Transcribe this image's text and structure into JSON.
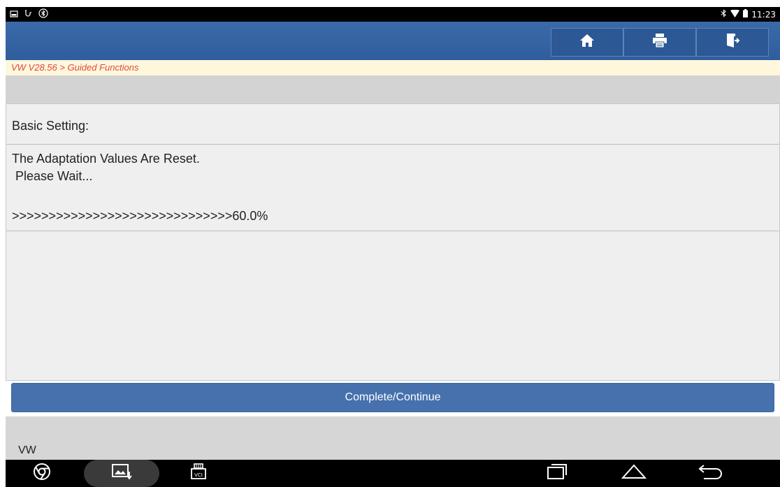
{
  "status_bar": {
    "time": "11:23"
  },
  "header": {
    "buttons": [
      {
        "name": "home",
        "icon": "home-icon"
      },
      {
        "name": "print",
        "icon": "printer-icon"
      },
      {
        "name": "exit",
        "icon": "exit-door-icon"
      }
    ]
  },
  "breadcrumb": "VW V28.56 > Guided Functions",
  "panel": {
    "title": "Basic Setting:",
    "message_line1": "The Adaptation Values Are Reset.",
    "message_line2": " Please Wait...",
    "progress_text": ">>>>>>>>>>>>>>>>>>>>>>>>>>>>>>60.0%",
    "progress_percent": 60.0
  },
  "continue_button": "Complete/Continue",
  "footer": {
    "brand": "VW"
  },
  "colors": {
    "header": "#2f5d9e",
    "breadcrumb_text": "#e0483a",
    "button": "#4671ad"
  }
}
